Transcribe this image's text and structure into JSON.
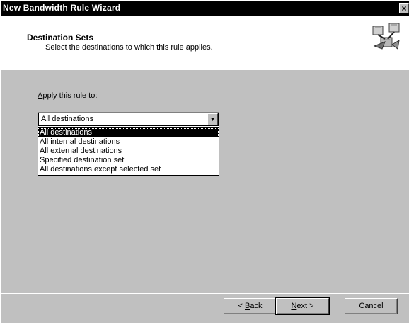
{
  "window": {
    "title": "New Bandwidth Rule Wizard",
    "close_glyph": "×"
  },
  "header": {
    "title": "Destination Sets",
    "subtitle": "Select the destinations to which this rule applies.",
    "icon": "wizard-network-icon"
  },
  "form": {
    "apply_label_accel": "A",
    "apply_label_rest": "pply this rule to:",
    "combo_value": "All destinations",
    "combo_arrow": "▼",
    "options": [
      "All destinations",
      "All internal destinations",
      "All external destinations",
      "Specified destination set",
      "All destinations except selected set"
    ]
  },
  "buttons": {
    "back_prefix": "< ",
    "back_accel": "B",
    "back_rest": "ack",
    "next_accel": "N",
    "next_rest": "ext >",
    "cancel": "Cancel"
  },
  "colors": {
    "face": "#c0c0c0",
    "titlebar": "#000000",
    "selection": "#000000",
    "header_bg": "#ffffff"
  }
}
